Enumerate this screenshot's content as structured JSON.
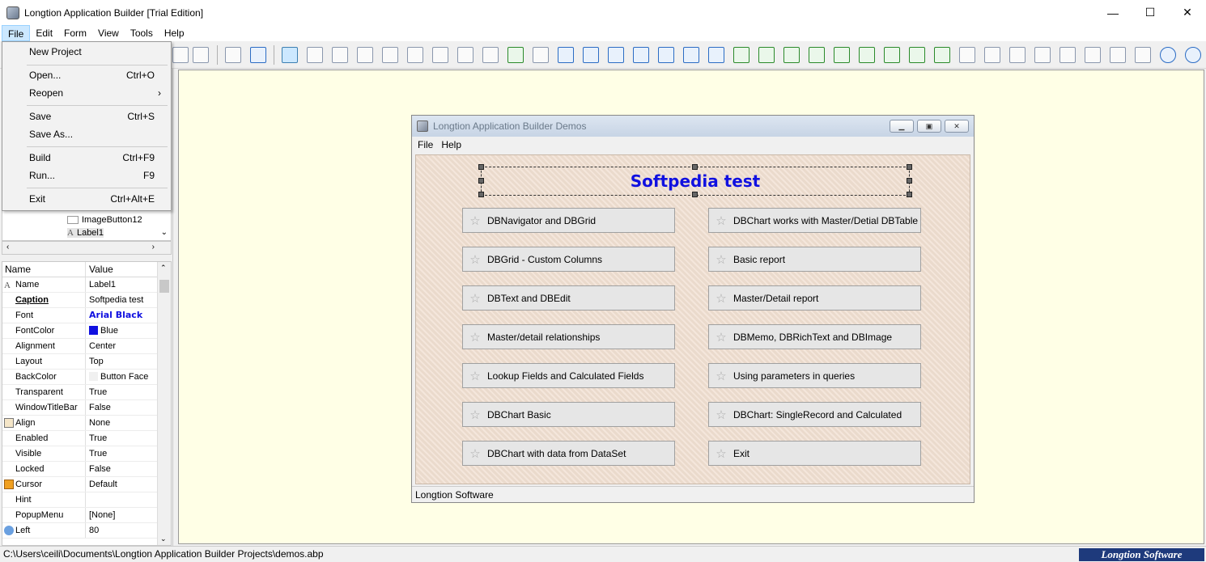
{
  "window": {
    "title": "Longtion Application Builder [Trial Edition]",
    "minimize": "—",
    "maximize": "☐",
    "close": "✕"
  },
  "menubar": [
    "File",
    "Edit",
    "Form",
    "View",
    "Tools",
    "Help"
  ],
  "file_menu": {
    "items": [
      {
        "label": "New Project",
        "shortcut": ""
      },
      {
        "label": "Open...",
        "shortcut": "Ctrl+O"
      },
      {
        "label": "Reopen",
        "shortcut": "›"
      },
      {
        "label": "Save",
        "shortcut": "Ctrl+S"
      },
      {
        "label": "Save As...",
        "shortcut": ""
      },
      {
        "label": "Build",
        "shortcut": "Ctrl+F9"
      },
      {
        "label": "Run...",
        "shortcut": "F9"
      },
      {
        "label": "Exit",
        "shortcut": "Ctrl+Alt+E"
      }
    ]
  },
  "tree": {
    "items": [
      "ImageButton12",
      "Label1"
    ]
  },
  "props": {
    "col_name": "Name",
    "col_value": "Value",
    "rows": [
      {
        "name": "Name",
        "value": "Label1"
      },
      {
        "name": "Caption",
        "value": "Softpedia test"
      },
      {
        "name": "Font",
        "value": "Arial Black"
      },
      {
        "name": "FontColor",
        "value": "Blue"
      },
      {
        "name": "Alignment",
        "value": "Center"
      },
      {
        "name": "Layout",
        "value": "Top"
      },
      {
        "name": "BackColor",
        "value": "Button Face"
      },
      {
        "name": "Transparent",
        "value": "True"
      },
      {
        "name": "WindowTitleBar",
        "value": "False"
      },
      {
        "name": "Align",
        "value": "None"
      },
      {
        "name": "Enabled",
        "value": "True"
      },
      {
        "name": "Visible",
        "value": "True"
      },
      {
        "name": "Locked",
        "value": "False"
      },
      {
        "name": "Cursor",
        "value": "Default"
      },
      {
        "name": "Hint",
        "value": ""
      },
      {
        "name": "PopupMenu",
        "value": "[None]"
      },
      {
        "name": "Left",
        "value": "80"
      }
    ]
  },
  "demo": {
    "title": "Longtion Application Builder Demos",
    "menu": [
      "File",
      "Help"
    ],
    "headline": "Softpedia test",
    "buttons_left": [
      "DBNavigator and DBGrid",
      "DBGrid - Custom Columns",
      "DBText and DBEdit",
      "Master/detail relationships",
      "Lookup Fields and Calculated Fields",
      "DBChart Basic",
      "DBChart with data from DataSet"
    ],
    "buttons_right": [
      "DBChart works with Master/Detial DBTable",
      "Basic report",
      "Master/Detail report",
      "DBMemo, DBRichText and DBImage",
      "Using parameters in queries",
      "DBChart: SingleRecord and Calculated",
      "Exit"
    ],
    "status": "Longtion Software"
  },
  "statusbar": {
    "path": "C:\\Users\\ceili\\Documents\\Longtion Application Builder Projects\\demos.abp",
    "brand": "Longtion Software"
  },
  "colors": {
    "font_color_swatch": "#1010e0",
    "headline": "#1010e0",
    "brand_bg": "#1e3a7c"
  }
}
